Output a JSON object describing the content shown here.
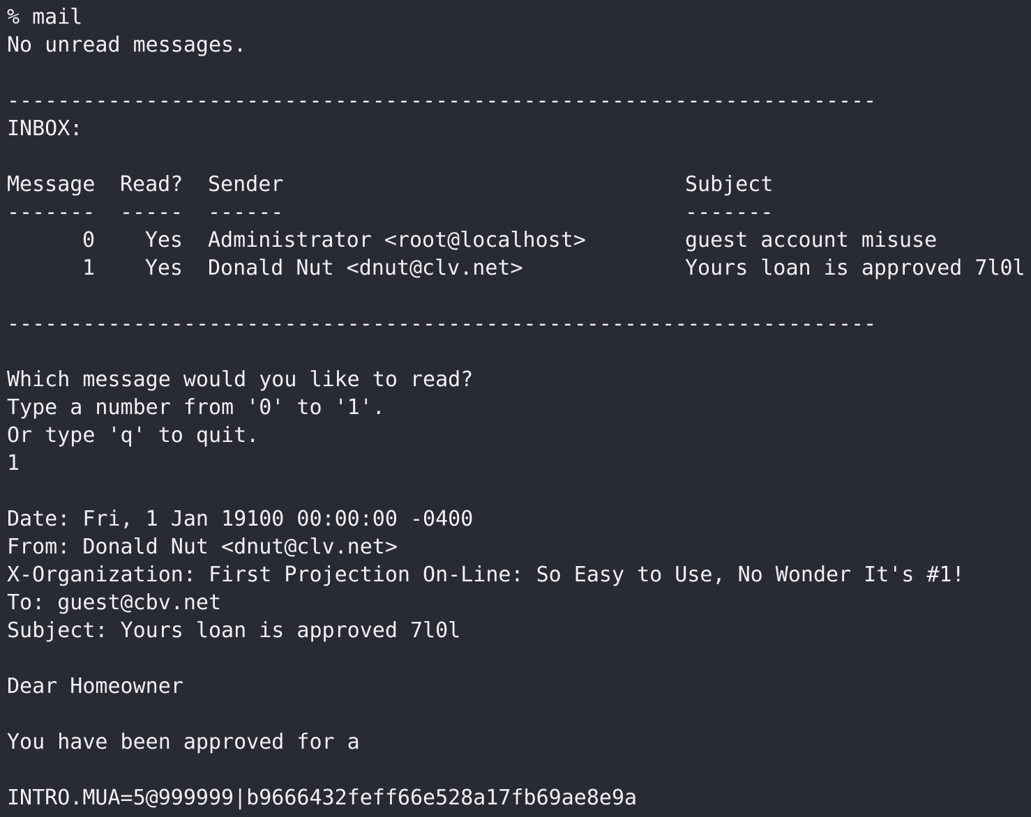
{
  "terminal": {
    "command": "% mail",
    "status": "No unread messages.",
    "separator": "---------------------------------------------------------------------",
    "inbox_label": "INBOX:",
    "table": {
      "headers": {
        "message": "Message",
        "read": "Read?",
        "sender": "Sender",
        "subject": "Subject"
      },
      "underlines": {
        "message": "-------",
        "read": "-----",
        "sender": "------",
        "subject": "-------"
      },
      "rows": [
        {
          "message": "0",
          "read": "Yes",
          "sender": "Administrator <root@localhost>",
          "subject": "guest account misuse"
        },
        {
          "message": "1",
          "read": "Yes",
          "sender": "Donald Nut <dnut@clv.net>",
          "subject": "Yours loan is approved 7l0l"
        }
      ]
    },
    "prompt": {
      "question": "Which message would you like to read?",
      "range": "Type a number from '0' to '1'.",
      "quit": "Or type 'q' to quit.",
      "input": "1"
    },
    "message": {
      "date": "Date: Fri, 1 Jan 19100 00:00:00 -0400",
      "from": "From: Donald Nut <dnut@clv.net>",
      "organization": "X-Organization: First Projection On-Line: So Easy to Use, No Wonder It's #1!",
      "to": "To: guest@cbv.net",
      "subject": "Subject: Yours loan is approved 7l0l",
      "greeting": "Dear Homeowner",
      "body": "You have been approved for a",
      "intro": "INTRO.MUA=5@999999|b9666432feff66e528a17fb69ae8e9a"
    }
  }
}
